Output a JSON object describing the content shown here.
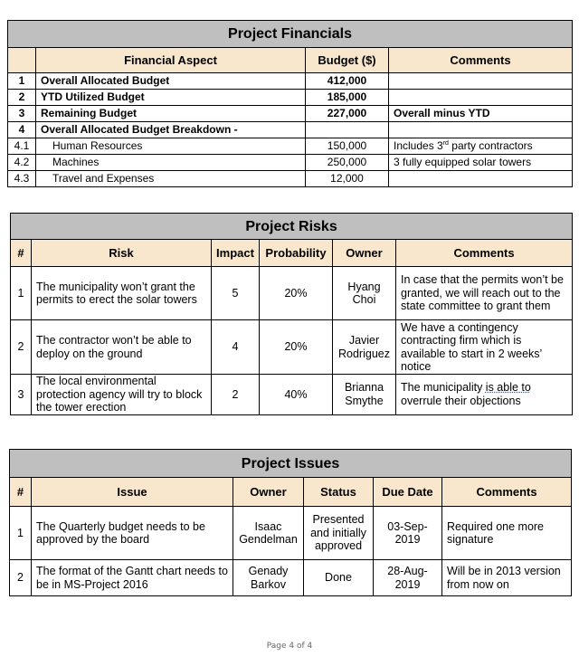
{
  "financials": {
    "title": "Project Financials",
    "headers": [
      "",
      "Financial Aspect",
      "Budget ($)",
      "Comments"
    ],
    "rows": [
      {
        "num": "1",
        "aspect": "Overall Allocated Budget",
        "budget": "412,000",
        "comment": "",
        "bold": true
      },
      {
        "num": "2",
        "aspect": "YTD Utilized Budget",
        "budget": "185,000",
        "comment": "",
        "bold": true
      },
      {
        "num": "3",
        "aspect": "Remaining Budget",
        "budget": "227,000",
        "comment": "Overall minus YTD",
        "bold": true
      },
      {
        "num": "4",
        "aspect": "Overall Allocated Budget Breakdown -",
        "budget": "",
        "comment": "",
        "bold": true
      },
      {
        "num": "4.1",
        "aspect": "Human Resources",
        "budget": "150,000",
        "comment_pre": "Includes 3",
        "comment_sup": "rd",
        "comment_post": " party contractors"
      },
      {
        "num": "4.2",
        "aspect": "Machines",
        "budget": "250,000",
        "comment": "3 fully equipped solar towers"
      },
      {
        "num": "4.3",
        "aspect": "Travel and Expenses",
        "budget": "12,000",
        "comment": ""
      }
    ]
  },
  "risks": {
    "title": "Project Risks",
    "headers": [
      "#",
      "Risk",
      "Impact",
      "Probability",
      "Owner",
      "Comments"
    ],
    "rows": [
      {
        "num": "1",
        "risk": "The municipality won’t grant the permits to erect the solar towers",
        "impact": "5",
        "probability": "20%",
        "owner": "Hyang Choi",
        "comment": "In case that the permits won’t be granted, we will reach out to the state committee to grant them"
      },
      {
        "num": "2",
        "risk": "The contractor won’t be able to deploy on the ground",
        "impact": "4",
        "probability": "20%",
        "owner": "Javier Rodriguez",
        "comment": "We have a contingency contracting firm which is available to start in 2 weeks’ notice"
      },
      {
        "num": "3",
        "risk": "The local environmental protection agency will try to block the tower erection",
        "impact": "2",
        "probability": "40%",
        "owner": "Brianna Smythe",
        "comment_pre": "The municipality ",
        "comment_flagged": "is able to",
        "comment_post": " overrule their objections"
      }
    ]
  },
  "issues": {
    "title": "Project Issues",
    "headers": [
      "#",
      "Issue",
      "Owner",
      "Status",
      "Due Date",
      "Comments"
    ],
    "rows": [
      {
        "num": "1",
        "issue": "The Quarterly budget needs to be approved by the board",
        "owner": "Isaac Gendelman",
        "status": "Presented and initially approved",
        "due": "03-Sep-2019",
        "comment": "Required one more signature"
      },
      {
        "num": "2",
        "issue": "The format of the Gantt chart needs to be in MS-Project 2016",
        "owner": "Genady Barkov",
        "status": "Done",
        "due": "28-Aug-2019",
        "comment": "Will be in 2013 version from now on"
      }
    ]
  },
  "footer": {
    "page_label": "Page 4 of 4"
  }
}
